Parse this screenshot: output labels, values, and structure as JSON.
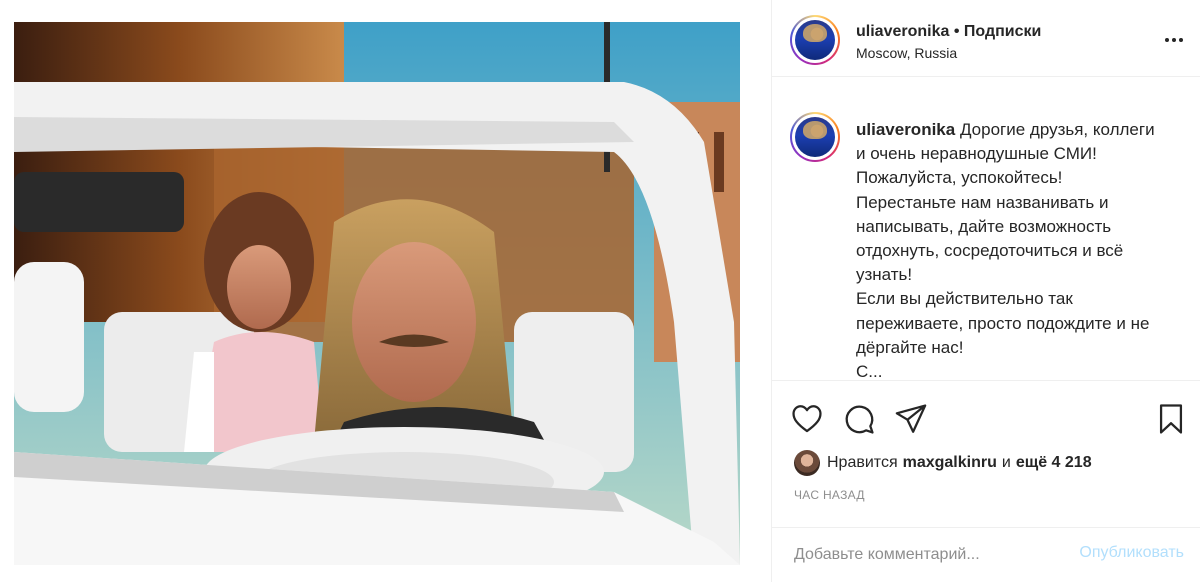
{
  "post": {
    "author": "uliaveronika",
    "separator": "•",
    "follow_label": "Подписки",
    "location": "Moscow, Russia"
  },
  "caption": {
    "username": "uliaveronika",
    "lines": [
      "Дорогие друзья, коллеги и очень неравнодушные СМИ!",
      "Пожалуйста, успокойтесь!",
      "Перестаньте нам названивать и написывать, дайте возможность отдохнуть, сосредоточиться и всё узнать!",
      "Если вы действительно так переживаете, просто подождите и не дёргайте нас!",
      "С..."
    ]
  },
  "actions": {
    "like_icon": "heart-icon",
    "comment_icon": "speech-bubble-icon",
    "share_icon": "paper-plane-icon",
    "save_icon": "bookmark-icon"
  },
  "likes": {
    "prefix": "Нравится",
    "user": "maxgalkinru",
    "conjunction": "и",
    "others": "ещё 4 218"
  },
  "timestamp": "ЧАС НАЗАД",
  "comment": {
    "placeholder": "Добавьте комментарий...",
    "publish_label": "Опубликовать"
  },
  "colors": {
    "text": "#262626",
    "secondary": "#8e8e8e",
    "publish_disabled": "#b2dffc",
    "divider": "#efefef"
  }
}
